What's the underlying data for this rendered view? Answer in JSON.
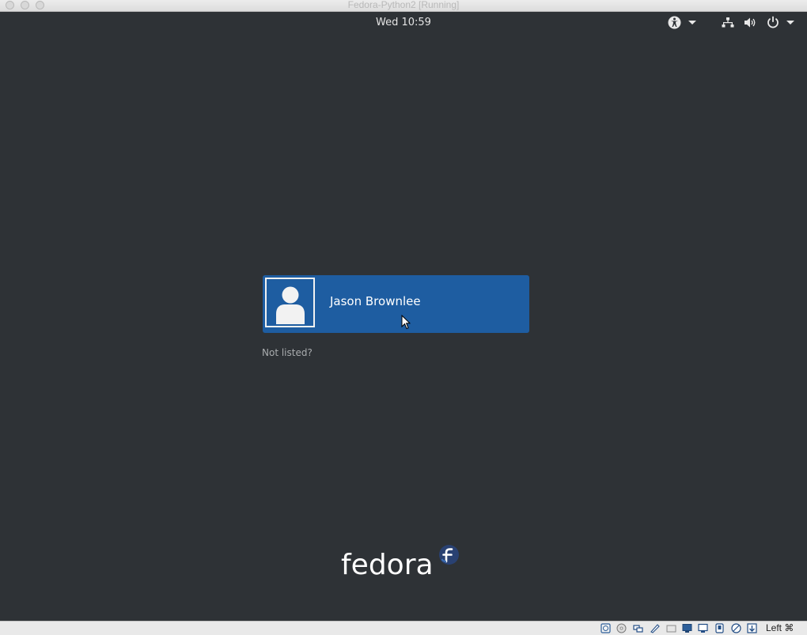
{
  "window": {
    "title": "Fedora-Python2 [Running]"
  },
  "top_bar": {
    "clock": "Wed 10:59",
    "icons": [
      "accessibility-icon",
      "network-icon",
      "volume-icon",
      "power-icon"
    ]
  },
  "login": {
    "user_name": "Jason Brownlee",
    "not_listed": "Not listed?"
  },
  "branding": {
    "logo_text": "fedora"
  },
  "status_bar": {
    "icons": [
      "hard-disk-icon",
      "optical-drive-icon",
      "usb-icon",
      "shared-folder-icon",
      "display-icon",
      "network-adapter-icon",
      "recording-icon",
      "video-capture-icon",
      "cpu-icon",
      "mouse-integration-icon",
      "keyboard-capture-icon"
    ],
    "host_key": "Left ⌘"
  },
  "colors": {
    "background": "#2e3236",
    "tile": "#1e5da1",
    "fedora_blue": "#294172"
  }
}
